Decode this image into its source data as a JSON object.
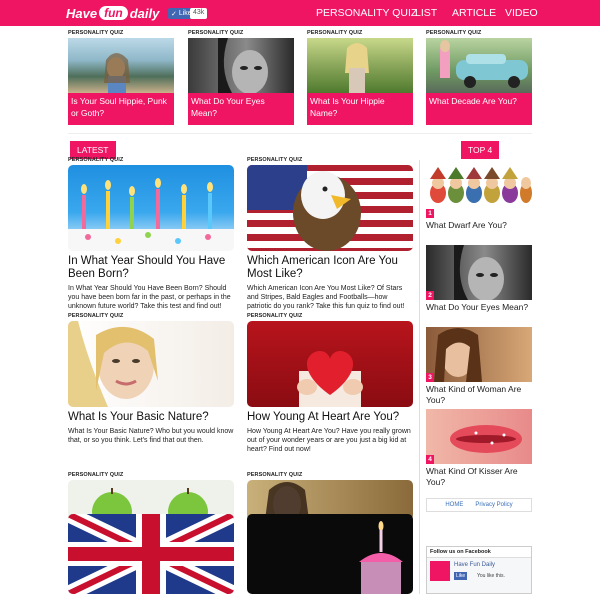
{
  "header": {
    "logo": {
      "pre": "Have",
      "fun": "fun",
      "post": "daily"
    },
    "like": "Like",
    "like_count": "43k",
    "nav": [
      "PERSONALITY QUIZ",
      "LIST",
      "ARTICLE",
      "VIDEO"
    ]
  },
  "top_quizzes": [
    {
      "label": "PERSONALITY QUIZ",
      "title": "Is Your Soul Hippie, Punk or Goth?"
    },
    {
      "label": "PERSONALITY QUIZ",
      "title": "What Do Your Eyes Mean?"
    },
    {
      "label": "PERSONALITY QUIZ",
      "title": "What Is Your Hippie Name?"
    },
    {
      "label": "PERSONALITY QUIZ",
      "title": "What Decade Are You?"
    }
  ],
  "latest": {
    "tag": "LATEST",
    "articles": [
      {
        "label": "PERSONALITY QUIZ",
        "title": "In What Year Should You Have Been Born?",
        "desc": "In What Year Should You Have Been Born? Should you have been born far in the past, or perhaps in the unknown future world? Take this test and find out!"
      },
      {
        "label": "PERSONALITY QUIZ",
        "title": "Which American Icon Are You Most Like?",
        "desc": "Which American Icon Are You Most Like? Of Stars and Stripes, Bald Eagles and Footballs—how patriotic do you rank? Take this fun quiz to find out!"
      },
      {
        "label": "PERSONALITY QUIZ",
        "title": "What Is Your Basic Nature?",
        "desc": "What Is Your Basic Nature? Who but you would know that, or so you think. Let's find that out then."
      },
      {
        "label": "PERSONALITY QUIZ",
        "title": "How Young At Heart Are You?",
        "desc": "How Young At Heart Are You? Have you really grown out of your wonder years or are you just a big kid at heart? Find out now!"
      },
      {
        "label": "PERSONALITY QUIZ",
        "title": "",
        "desc": ""
      },
      {
        "label": "PERSONALITY QUIZ",
        "title": "",
        "desc": ""
      }
    ]
  },
  "top4": {
    "tag": "TOP 4",
    "items": [
      {
        "rank": "1",
        "title": "What Dwarf Are You?"
      },
      {
        "rank": "2",
        "title": "What Do Your Eyes Mean?"
      },
      {
        "rank": "3",
        "title": "What Kind of Woman Are You?"
      },
      {
        "rank": "4",
        "title": "What Kind Of Kisser Are You?"
      }
    ]
  },
  "footer_links": [
    "HOME",
    "Privacy Policy"
  ],
  "facebook": {
    "heading": "Follow us on Facebook",
    "page_name": "Have Fun Daily",
    "like": "Like",
    "text": "You like this."
  },
  "colors": {
    "brand": "#f01563",
    "facebook": "#4267b2"
  }
}
